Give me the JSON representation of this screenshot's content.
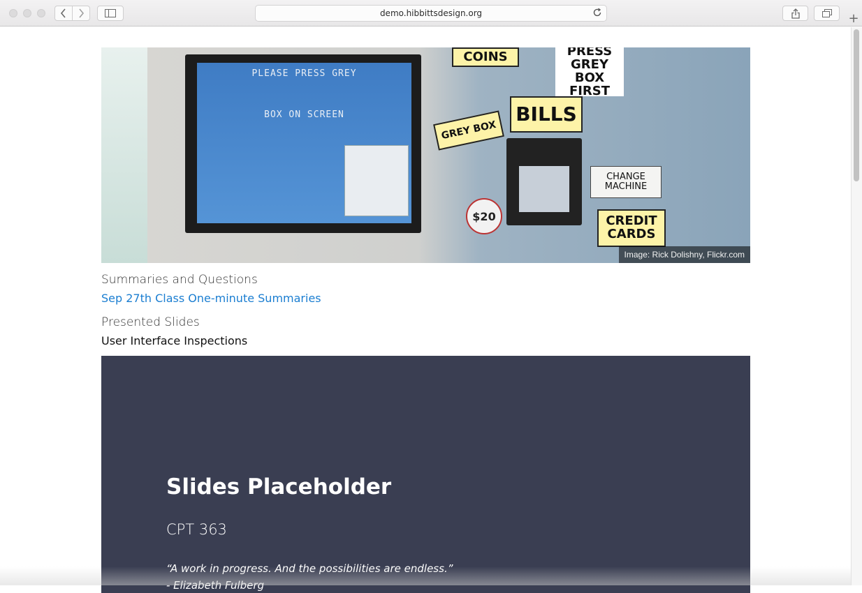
{
  "browser": {
    "url": "demo.hibbittsdesign.org",
    "icons": {
      "back": "chevron-left-icon",
      "forward": "chevron-right-icon",
      "sidebar": "sidebar-icon",
      "reload": "reload-icon",
      "share": "share-icon",
      "tabs": "tabs-overview-icon",
      "new_tab": "plus-icon"
    },
    "new_tab_glyph": "+"
  },
  "hero": {
    "caption": "Image: Rick Dolishny, Flickr.com",
    "screen_line1": "PLEASE PRESS GREY",
    "screen_line2": "BOX ON SCREEN",
    "sign_coins": "COINS",
    "sign_press": "PRESS GREY BOX FIRST",
    "sign_bills": "BILLS",
    "sign_grey_box": "GREY BOX",
    "sign_change": "CHANGE MACHINE",
    "sign_credit": "CREDIT CARDS",
    "sign_twenty": "$20"
  },
  "sections": {
    "summaries_heading": "Summaries and Questions",
    "summaries_link": "Sep 27th Class One-minute Summaries",
    "slides_heading": "Presented Slides",
    "slides_title": "User Interface Inspections"
  },
  "slides": {
    "heading": "Slides Placeholder",
    "subheading": "CPT 363",
    "quote": "“A work in progress. And the possibilities are endless.”",
    "attribution": "- Elizabeth Fulberg"
  },
  "colors": {
    "link": "#1b7ed1",
    "slides_bg": "#3a3e52"
  }
}
